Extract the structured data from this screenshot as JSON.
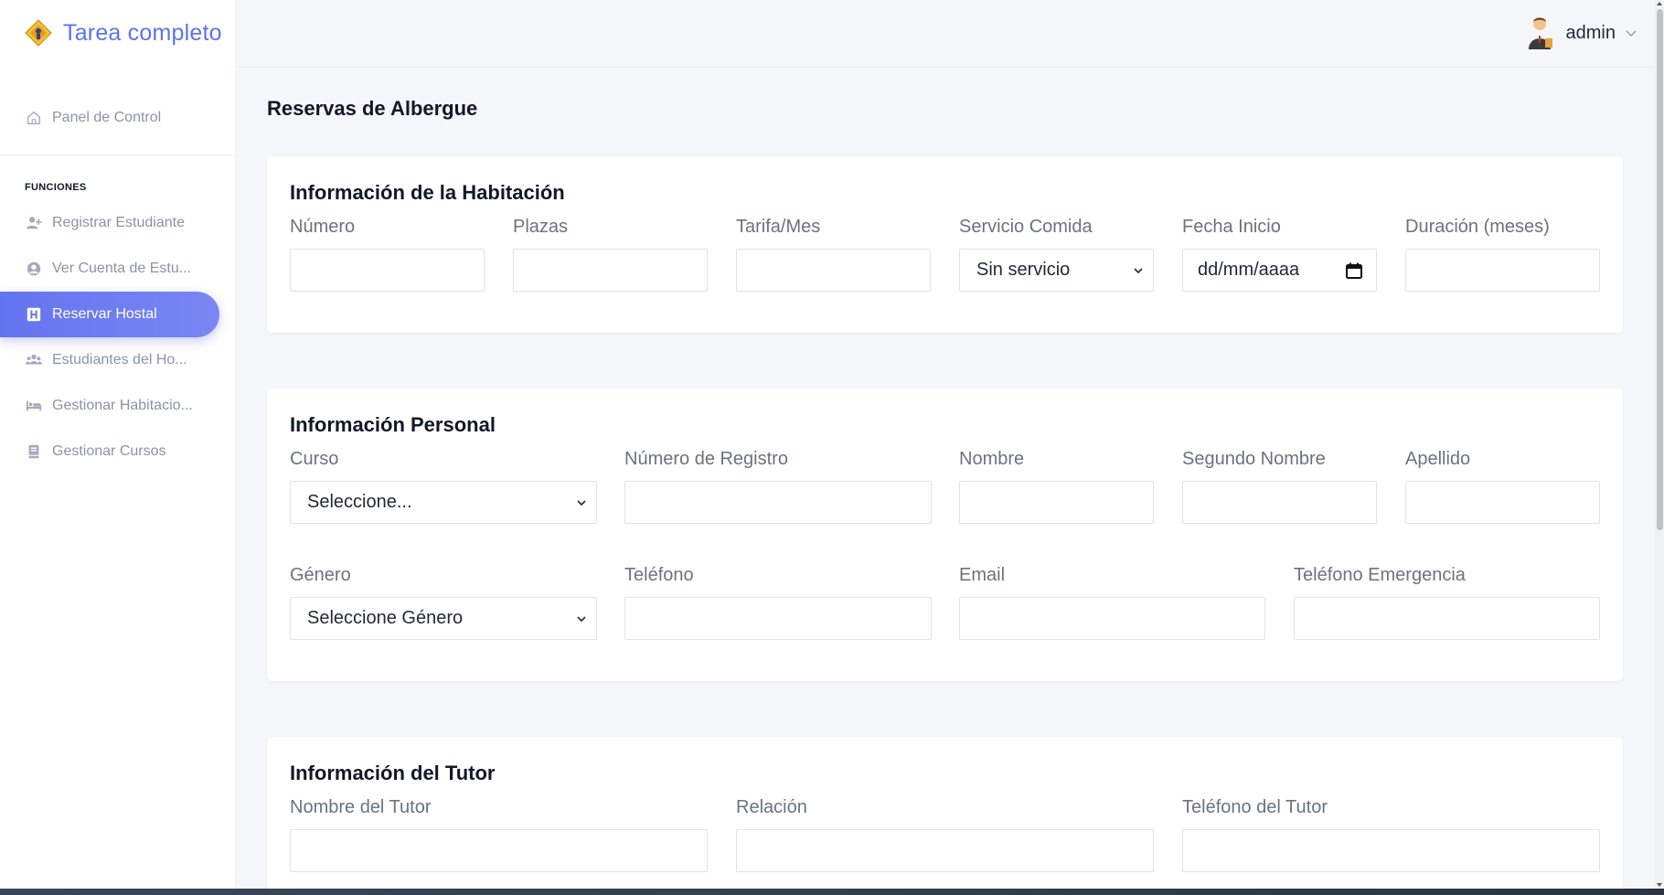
{
  "app": {
    "title": "Tarea completo"
  },
  "user": {
    "name": "admin"
  },
  "sidebar": {
    "top_item": "Panel de Control",
    "section_title": "FUNCIONES",
    "items": [
      {
        "label": "Registrar Estudiante",
        "icon": "user-plus-icon"
      },
      {
        "label": "Ver Cuenta de Estu...",
        "icon": "user-circle-icon"
      },
      {
        "label": "Reservar Hostal",
        "icon": "hostal-h-icon",
        "active": true
      },
      {
        "label": "Estudiantes del Ho...",
        "icon": "users-group-icon"
      },
      {
        "label": "Gestionar Habitacio...",
        "icon": "bed-icon"
      },
      {
        "label": "Gestionar Cursos",
        "icon": "book-icon"
      }
    ]
  },
  "page": {
    "title": "Reservas de Albergue"
  },
  "room": {
    "title": "Información de la Habitación",
    "numero": {
      "label": "Número",
      "value": ""
    },
    "plazas": {
      "label": "Plazas",
      "value": ""
    },
    "tarifa": {
      "label": "Tarifa/Mes",
      "value": ""
    },
    "comida": {
      "label": "Servicio Comida",
      "value": "Sin servicio"
    },
    "fecha": {
      "label": "Fecha Inicio",
      "value": "dd/mm/aaaa"
    },
    "duracion": {
      "label": "Duración (meses)",
      "value": ""
    }
  },
  "personal": {
    "title": "Información Personal",
    "curso": {
      "label": "Curso",
      "value": "Seleccione..."
    },
    "registro": {
      "label": "Número de Registro",
      "value": ""
    },
    "nombre": {
      "label": "Nombre",
      "value": ""
    },
    "segundo": {
      "label": "Segundo Nombre",
      "value": ""
    },
    "apellido": {
      "label": "Apellido",
      "value": ""
    },
    "genero": {
      "label": "Género",
      "value": "Seleccione Género"
    },
    "telefono": {
      "label": "Teléfono",
      "value": ""
    },
    "email": {
      "label": "Email",
      "value": ""
    },
    "emergencia": {
      "label": "Teléfono Emergencia",
      "value": ""
    }
  },
  "tutor": {
    "title": "Información del Tutor",
    "nombre": {
      "label": "Nombre del Tutor",
      "value": ""
    },
    "relacion": {
      "label": "Relación",
      "value": ""
    },
    "telefono": {
      "label": "Teléfono del Tutor",
      "value": ""
    }
  },
  "colors": {
    "accent": "#6474ef",
    "brand": "#5b74e8",
    "muted": "#8a93a6"
  }
}
